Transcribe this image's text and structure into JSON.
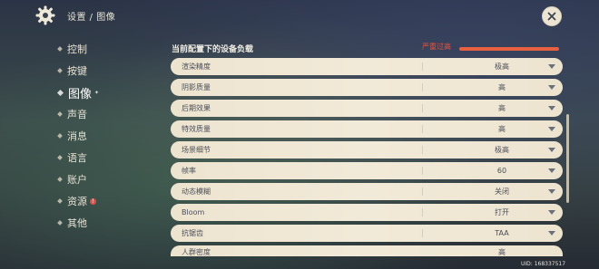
{
  "header": {
    "breadcrumb": "设置 / 图像",
    "close_label": "✕"
  },
  "sidebar": {
    "items": [
      {
        "label": "控制",
        "active": false
      },
      {
        "label": "按键",
        "active": false
      },
      {
        "label": "图像",
        "active": true
      },
      {
        "label": "声音",
        "active": false
      },
      {
        "label": "消息",
        "active": false
      },
      {
        "label": "语言",
        "active": false
      },
      {
        "label": "账户",
        "active": false
      },
      {
        "label": "资源",
        "active": false,
        "badge": "!"
      },
      {
        "label": "其他",
        "active": false
      }
    ]
  },
  "load": {
    "title": "当前配置下的设备负载",
    "status": "严重过高",
    "level": 1.0
  },
  "settings": [
    {
      "label": "渲染精度",
      "value": "极高"
    },
    {
      "label": "阴影质量",
      "value": "高"
    },
    {
      "label": "后期效果",
      "value": "高"
    },
    {
      "label": "特效质量",
      "value": "高"
    },
    {
      "label": "场景细节",
      "value": "极高"
    },
    {
      "label": "帧率",
      "value": "60"
    },
    {
      "label": "动态模糊",
      "value": "关闭"
    },
    {
      "label": "Bloom",
      "value": "打开"
    },
    {
      "label": "抗锯齿",
      "value": "TAA"
    },
    {
      "label": "人群密度",
      "value": "高"
    }
  ],
  "footer": {
    "uid": "UID: 168337517"
  },
  "colors": {
    "accent_warning": "#e8603f",
    "row_background": "#f0e8d6"
  }
}
